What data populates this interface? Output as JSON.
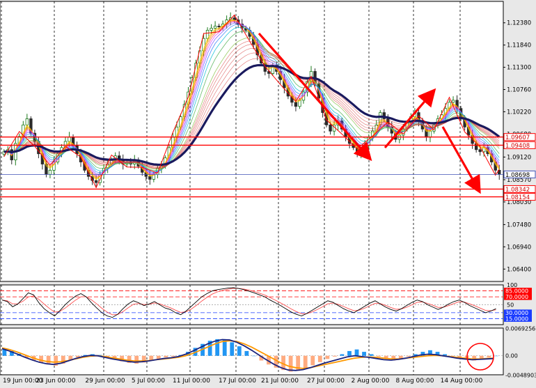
{
  "chart_data": [
    {
      "type": "candlestick",
      "panel": "price",
      "ylim": [
        1.061,
        1.129
      ],
      "y_ticks": [
        "1.12380",
        "1.11840",
        "1.11300",
        "1.10760",
        "1.10220",
        "1.09680",
        "1.09120",
        "1.08570",
        "1.08030",
        "1.07480",
        "1.06940",
        "1.06400"
      ],
      "x_ticks": [
        "19 Jun 00:00",
        "23 Jun 00:00",
        "29 Jun 00:00",
        "5 Jul 00:00",
        "11 Jul 00:00",
        "17 Jul 00:00",
        "21 Jul 00:00",
        "27 Jul 00:00",
        "2 Aug 00:00",
        "8 Aug 00:00",
        "14 Aug 00:00"
      ],
      "horizontal_lines": [
        {
          "value": 1.09607,
          "label": "1.09607",
          "color": "#ff0000"
        },
        {
          "value": 1.09408,
          "label": "1.09408",
          "color": "#ff0000"
        },
        {
          "value": 1.08698,
          "label": "1.08698",
          "color": "#3f51b5"
        },
        {
          "value": 1.08342,
          "label": "1.08342",
          "color": "#ff0000"
        },
        {
          "value": 1.08154,
          "label": "1.08154",
          "color": "#ff0000"
        }
      ],
      "close_path": [
        1.0925,
        1.093,
        1.0905,
        1.0945,
        1.0962,
        1.099,
        1.1005,
        1.097,
        1.095,
        1.092,
        1.0895,
        1.087,
        1.088,
        1.09,
        1.092,
        1.0935,
        1.095,
        1.096,
        1.094,
        1.092,
        1.09,
        1.088,
        1.0865,
        1.0855,
        1.085,
        1.087,
        1.0885,
        1.0895,
        1.0905,
        1.0915,
        1.0905,
        1.0895,
        1.09,
        1.0895,
        1.0905,
        1.089,
        1.0875,
        1.0865,
        1.0858,
        1.087,
        1.0885,
        1.089,
        1.091,
        1.0935,
        1.096,
        1.0985,
        1.101,
        1.104,
        1.107,
        1.1105,
        1.114,
        1.117,
        1.12,
        1.122,
        1.1225,
        1.123,
        1.1228,
        1.1235,
        1.1245,
        1.125,
        1.1245,
        1.1235,
        1.1225,
        1.122,
        1.1205,
        1.1185,
        1.116,
        1.114,
        1.112,
        1.1115,
        1.1135,
        1.112,
        1.11,
        1.108,
        1.106,
        1.1045,
        1.1035,
        1.105,
        1.107,
        1.1095,
        1.112,
        1.109,
        1.1055,
        1.102,
        1.099,
        1.0975,
        1.099,
        1.1,
        1.098,
        1.096,
        1.0945,
        1.0935,
        1.092,
        1.0925,
        1.094,
        1.096,
        1.0975,
        1.099,
        1.102,
        1.1005,
        1.0985,
        1.097,
        1.0955,
        1.0965,
        1.098,
        1.0995,
        1.101,
        1.102,
        1.1,
        1.098,
        1.096,
        1.0975,
        1.099,
        1.1005,
        1.1015,
        1.103,
        1.1045,
        1.105,
        1.103,
        1.1005,
        1.0985,
        1.0965,
        1.0945,
        1.093,
        1.0925,
        1.0935,
        1.092,
        1.09,
        1.088,
        1.087
      ]
    },
    {
      "type": "line",
      "panel": "oscillator",
      "ylim": [
        0,
        100
      ],
      "y_ticks": [
        "100",
        "85.0000",
        "70.0000",
        "50",
        "30.0000",
        "15.0000"
      ],
      "levels": [
        85,
        70,
        50,
        30,
        15
      ],
      "series": [
        {
          "values": [
            62,
            58,
            45,
            52,
            66,
            80,
            75,
            55,
            40,
            30,
            22,
            35,
            50,
            62,
            72,
            78,
            70,
            55,
            42,
            30,
            22,
            18,
            26,
            40,
            52,
            60,
            55,
            48,
            52,
            58,
            50,
            42,
            38,
            30,
            25,
            34,
            46,
            58,
            70,
            78,
            85,
            88,
            90,
            92,
            93,
            91,
            88,
            84,
            80,
            75,
            70,
            62,
            55,
            48,
            40,
            32,
            26,
            22,
            28,
            36,
            44,
            52,
            60,
            56,
            48,
            40,
            34,
            30,
            38,
            46,
            54,
            60,
            52,
            44,
            38,
            34,
            40,
            48,
            56,
            62,
            58,
            50,
            44,
            38,
            44,
            52,
            58,
            62,
            56,
            48,
            42,
            36,
            30,
            34,
            40
          ]
        }
      ]
    },
    {
      "type": "bar",
      "panel": "macd",
      "ylim": [
        -0.0048,
        0.007
      ],
      "y_ticks": [
        "0.0069256",
        "0.00",
        "-0.0048903"
      ],
      "histogram": [
        0.0018,
        0.0012,
        0.0005,
        -0.0005,
        -0.0012,
        -0.0018,
        -0.0022,
        -0.0025,
        -0.002,
        -0.0012,
        -0.0004,
        0.0002,
        0.0004,
        0.0002,
        -0.0004,
        -0.001,
        -0.0014,
        -0.0018,
        -0.002,
        -0.0017,
        -0.0012,
        -0.0008,
        -0.0004,
        -0.0002,
        0.0002,
        0.001,
        0.002,
        0.003,
        0.0038,
        0.0042,
        0.004,
        0.0034,
        0.0024,
        0.0012,
        0.0,
        -0.0012,
        -0.0022,
        -0.003,
        -0.0036,
        -0.004,
        -0.0038,
        -0.0032,
        -0.0024,
        -0.0016,
        -0.0008,
        -0.0002,
        0.0004,
        0.0012,
        0.0016,
        0.001,
        0.0004,
        -0.0002,
        -0.0008,
        -0.0012,
        -0.0008,
        -0.0002,
        0.0004,
        0.001,
        0.0014,
        0.001,
        0.0004,
        -0.0002,
        -0.0006,
        -0.001,
        -0.0012,
        -0.0008,
        -0.0004,
        0.0
      ],
      "signal": [
        0.002,
        0.0016,
        0.001,
        0.0003,
        -0.0004,
        -0.001,
        -0.0014,
        -0.0016,
        -0.0015,
        -0.0012,
        -0.0008,
        -0.0004,
        -0.0001,
        0.0,
        -0.0002,
        -0.0005,
        -0.0008,
        -0.0011,
        -0.0013,
        -0.0013,
        -0.0012,
        -0.001,
        -0.0008,
        -0.0006,
        -0.0004,
        0.0,
        0.0006,
        0.0014,
        0.0022,
        0.003,
        0.0036,
        0.0038,
        0.0036,
        0.003,
        0.0022,
        0.0012,
        0.0002,
        -0.0008,
        -0.0018,
        -0.0026,
        -0.003,
        -0.0032,
        -0.003,
        -0.0026,
        -0.0022,
        -0.0018,
        -0.0014,
        -0.001,
        -0.0006,
        -0.0004,
        -0.0003,
        -0.0004,
        -0.0006,
        -0.0008,
        -0.0008,
        -0.0006,
        -0.0004,
        -0.0002,
        0.0,
        0.0001,
        0.0,
        -0.0002,
        -0.0004,
        -0.0006,
        -0.0008,
        -0.0008,
        -0.0007,
        -0.0006
      ],
      "macd_line": [
        0.0018,
        0.0012,
        0.0005,
        -0.0003,
        -0.001,
        -0.0016,
        -0.002,
        -0.0022,
        -0.0019,
        -0.0013,
        -0.0007,
        -0.0002,
        0.0001,
        0.0,
        -0.0004,
        -0.0008,
        -0.0011,
        -0.0014,
        -0.0016,
        -0.0015,
        -0.0013,
        -0.001,
        -0.0007,
        -0.0005,
        -0.0002,
        0.0004,
        0.0012,
        0.0021,
        0.003,
        0.0037,
        0.0041,
        0.004,
        0.0034,
        0.0025,
        0.0014,
        0.0002,
        -0.001,
        -0.0021,
        -0.003,
        -0.0036,
        -0.0037,
        -0.0035,
        -0.003,
        -0.0024,
        -0.0018,
        -0.0013,
        -0.0008,
        -0.0003,
        0.0,
        -0.0002,
        -0.0004,
        -0.0007,
        -0.001,
        -0.0011,
        -0.0009,
        -0.0006,
        -0.0002,
        0.0002,
        0.0004,
        0.0003,
        0.0,
        -0.0003,
        -0.0006,
        -0.0008,
        -0.001,
        -0.0009,
        -0.0008,
        -0.0007
      ]
    }
  ],
  "colors": {
    "background": "#ffffff",
    "grid": "#000000",
    "bull": "#1b7a1b",
    "bear": "#2b2b2b",
    "trend": "#ff0000",
    "ma_main": "#1a1a5e",
    "macd_pos": "#2196f3",
    "macd_neg": "#ffab80",
    "signal": "#ff9800",
    "macd_line": "#1a237e",
    "osc_main": "#000000",
    "osc_ref": "#ff4d4d"
  }
}
